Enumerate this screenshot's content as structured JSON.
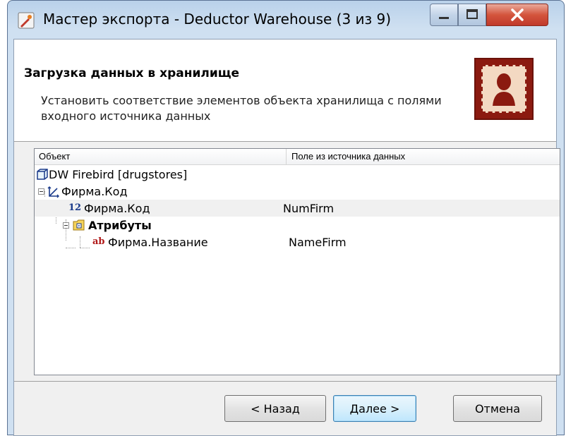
{
  "window": {
    "title": "Мастер экспорта - Deductor Warehouse (3 из 9)",
    "icon": "wizard-icon"
  },
  "header": {
    "title": "Загрузка данных в хранилище",
    "description": "Установить соответствие элементов объекта хранилища с полями входного источника данных",
    "image_icon": "stamp-icon"
  },
  "grid": {
    "columns": [
      "Объект",
      "Поле из источника данных"
    ],
    "rows": [
      {
        "object": "DW Firebird [drugstores]",
        "field": "",
        "icon": "database-icon"
      },
      {
        "object": "Фирма.Код",
        "field": "",
        "icon": "dimension-icon"
      },
      {
        "object": "Фирма.Код",
        "field": "NumFirm",
        "icon": "numeric-field-icon",
        "icon_text": "12"
      },
      {
        "object": "Атрибуты",
        "field": "",
        "icon": "attributes-folder-icon"
      },
      {
        "object": "Фирма.Название",
        "field": "NameFirm",
        "icon": "string-field-icon",
        "icon_text": "ab"
      }
    ]
  },
  "buttons": {
    "back": "< Назад",
    "next": "Далее >",
    "cancel": "Отмена"
  },
  "colors": {
    "numeric_icon": "#1a3a8a",
    "string_icon": "#b01818",
    "accent": "#3c7fb1"
  }
}
